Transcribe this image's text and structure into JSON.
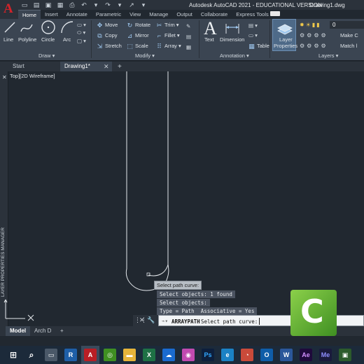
{
  "title": {
    "app": "Autodesk AutoCAD 2021 - EDUCATIONAL VERSION",
    "doc": "Drawing1.dwg"
  },
  "ribbon_tabs": [
    "Home",
    "Insert",
    "Annotate",
    "Parametric",
    "View",
    "Manage",
    "Output",
    "Collaborate",
    "Express Tools"
  ],
  "draw": {
    "line": "Line",
    "polyline": "Polyline",
    "circle": "Circle",
    "arc": "Arc",
    "panel": "Draw ▾"
  },
  "modify": {
    "move": "Move",
    "rotate": "Rotate",
    "trim": "Trim ▾",
    "copy": "Copy",
    "mirror": "Mirror",
    "fillet": "Fillet ▾",
    "stretch": "Stretch",
    "scale": "Scale",
    "array": "Array ▾",
    "panel": "Modify ▾"
  },
  "annotation": {
    "text": "Text",
    "dimension": "Dimension",
    "table": "Table",
    "panel": "Annotation ▾"
  },
  "layers": {
    "properties_l1": "Layer",
    "properties_l2": "Properties",
    "current": "0",
    "make": "Make C",
    "match": "Match l",
    "panel": "Layers ▾"
  },
  "file_tabs": {
    "start": "Start",
    "drawing": "Drawing1*"
  },
  "viewport_label": "Top][2D Wireframe]",
  "side_panel": {
    "label": "LAYER PROPERTIES MANAGER"
  },
  "tooltip": "Select path curve:",
  "history": [
    "Select objects: 1 found",
    "Select objects:",
    "Type = Path  Associative = Yes"
  ],
  "command": {
    "name": "ARRAYPATH",
    "prompt": "Select path curve:"
  },
  "layout_tabs": [
    "Model",
    "Arch D"
  ],
  "colors": {
    "background": "#212830",
    "ribbon": "#3b4552",
    "accent": "#d2232a",
    "camtasia": "#5eaa30"
  }
}
